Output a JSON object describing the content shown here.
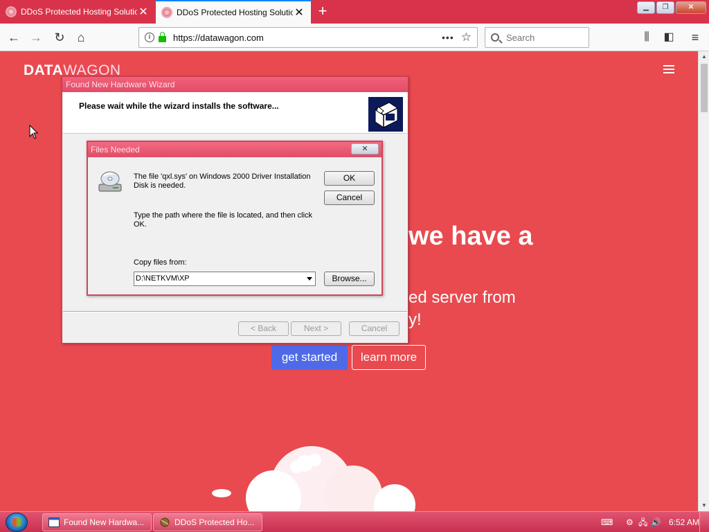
{
  "browser": {
    "tabs": [
      {
        "label": "DDoS Protected Hosting Solutio",
        "close": "✕"
      },
      {
        "label": "DDoS Protected Hosting Solutio",
        "close": "✕"
      }
    ],
    "new_tab": "+",
    "url": "https://datawagon.com",
    "page_actions": "•••",
    "search_placeholder": "Search",
    "accent_color": "#0a84ff"
  },
  "page": {
    "logo_bold": "DATA",
    "logo_light": "WAGON",
    "hero_title": "we have a",
    "hero_sub1": "ed server from",
    "hero_sub2": "y!",
    "btn_start": "get started",
    "btn_learn": "learn more",
    "background_color": "#e84a4f"
  },
  "wizard": {
    "title": "Found New Hardware Wizard",
    "heading": "Please wait while the wizard installs the software...",
    "back": "< Back",
    "next": "Next >",
    "cancel": "Cancel"
  },
  "files_needed": {
    "title": "Files Needed",
    "close": "✕",
    "message1": "The file 'qxl.sys' on Windows 2000 Driver Installation Disk is needed.",
    "message2": "Type the path where the file is located, and then click OK.",
    "copy_label": "Copy files from:",
    "copy_value": "D:\\NETKVM\\XP",
    "ok": "OK",
    "cancel": "Cancel",
    "browse": "Browse..."
  },
  "taskbar": {
    "items": [
      {
        "label": "Found New Hardwa..."
      },
      {
        "label": "DDoS Protected Ho..."
      }
    ],
    "clock": "6:52 AM"
  }
}
